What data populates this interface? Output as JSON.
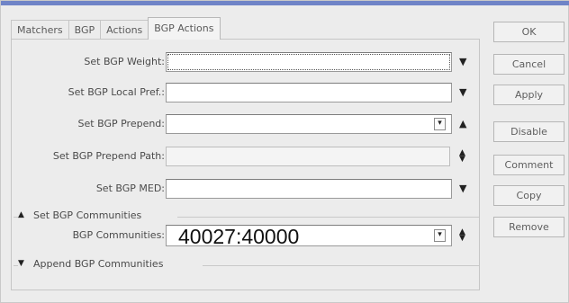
{
  "tabs": [
    {
      "label": "Matchers",
      "active": false
    },
    {
      "label": "BGP",
      "active": false
    },
    {
      "label": "Actions",
      "active": false
    },
    {
      "label": "BGP Actions",
      "active": true
    }
  ],
  "fields": {
    "weight": {
      "label": "Set BGP Weight:",
      "value": ""
    },
    "local_pref": {
      "label": "Set BGP Local Pref.:",
      "value": ""
    },
    "prepend": {
      "label": "Set BGP Prepend:",
      "value": ""
    },
    "prepend_path": {
      "label": "Set BGP Prepend Path:",
      "value": ""
    },
    "med": {
      "label": "Set BGP MED:",
      "value": ""
    }
  },
  "communities_section": {
    "title": "Set BGP Communities",
    "expanded": true,
    "field_label": "BGP Communities:",
    "value": "40027:40000"
  },
  "append_section": {
    "title": "Append BGP Communities",
    "expanded": false
  },
  "buttons": {
    "ok": "OK",
    "cancel": "Cancel",
    "apply": "Apply",
    "disable": "Disable",
    "comment": "Comment",
    "copy": "Copy",
    "remove": "Remove"
  },
  "icons": {
    "dropdown": "triangle-down-icon",
    "collapse": "triangle-up-icon",
    "expand": "triangle-down-icon",
    "updown": "up-down-spinner-icon",
    "mini_dropdown": "mini-dropdown-button-icon"
  },
  "colors": {
    "title_bar_accent": "#6f84c7",
    "window_bg": "#ececec",
    "field_bg": "#ffffff"
  }
}
